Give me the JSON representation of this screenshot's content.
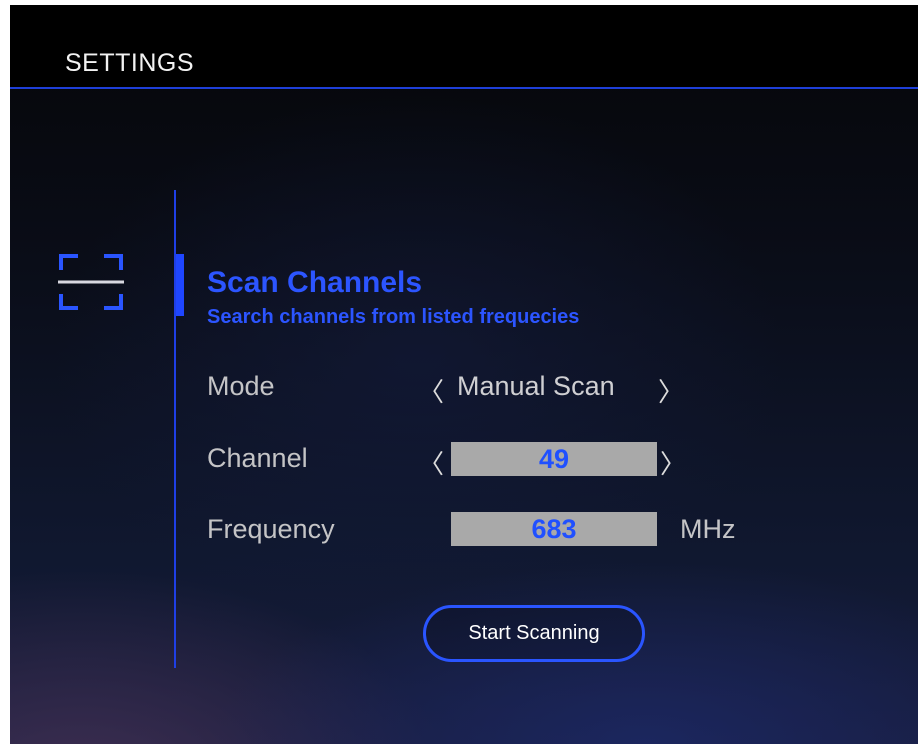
{
  "header": {
    "title": "SETTINGS"
  },
  "section": {
    "icon": "scan-frame-icon",
    "title": "Scan Channels",
    "subtitle": "Search channels from listed frequecies"
  },
  "mode": {
    "label": "Mode",
    "prev": "〈",
    "value": "Manual Scan",
    "next": "〉"
  },
  "channel": {
    "label": "Channel",
    "prev": "〈",
    "value": "49",
    "next": "〉"
  },
  "frequency": {
    "label": "Frequency",
    "value": "683",
    "unit": "MHz"
  },
  "actions": {
    "start_label": "Start Scanning"
  },
  "colors": {
    "accent": "#1f46ff",
    "header_bg": "#000000",
    "field_bg": "#a9a9a9"
  }
}
